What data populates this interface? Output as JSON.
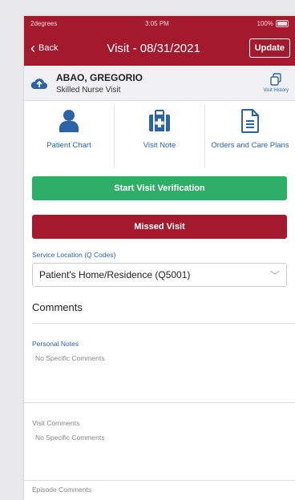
{
  "statusbar": {
    "carrier": "2degrees",
    "time": "3:05 PM",
    "battery": "100%"
  },
  "navbar": {
    "back_label": "Back",
    "title": "Visit - 08/31/2021",
    "update_label": "Update"
  },
  "patient": {
    "name": "ABAO, GREGORIO",
    "visit_type": "Skilled Nurse Visit",
    "history_label": "Visit History"
  },
  "actions": [
    {
      "label": "Patient Chart",
      "icon": "person-icon"
    },
    {
      "label": "Visit Note",
      "icon": "medical-kit-icon"
    },
    {
      "label": "Orders and Care Plans",
      "icon": "document-icon"
    }
  ],
  "buttons": {
    "start_verification": "Start Visit Verification",
    "missed_visit": "Missed Visit"
  },
  "service_location": {
    "label": "Service Location (Q Codes)",
    "value": "Patient's Home/Residence (Q5001)"
  },
  "comments": {
    "heading": "Comments",
    "personal_notes_label": "Personal Notes",
    "personal_notes_value": "No Specific Comments",
    "visit_comments_label": "Visit Comments",
    "visit_comments_value": "No Specific Comments",
    "episode_comments_label": "Episode Comments"
  },
  "colors": {
    "brand": "#a3192e",
    "accent": "#2a64a6",
    "success": "#2daf68"
  }
}
